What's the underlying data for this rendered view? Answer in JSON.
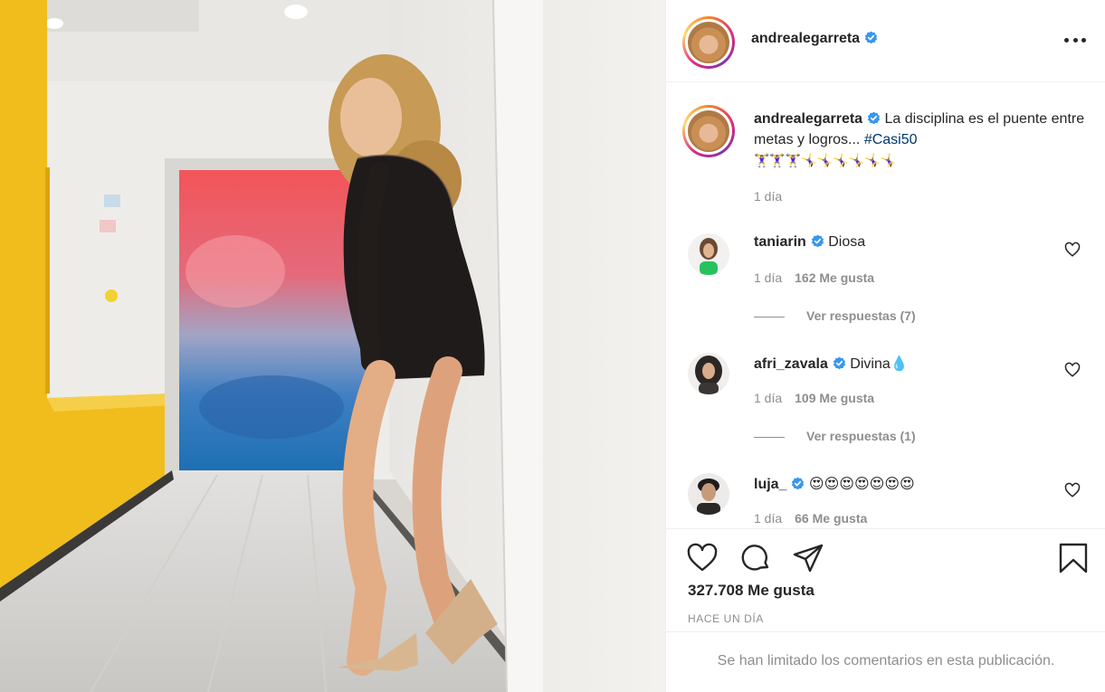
{
  "post": {
    "username": "andrealegarreta",
    "caption": {
      "text": "La disciplina es el puente entre metas y logros... ",
      "hashtag": "#Casi50",
      "emoji_row": "🏋️‍♀️🏋️‍♀️🏋️‍♀️🤸‍♀️🤸‍♀️🤸‍♀️🤸‍♀️🤸‍♀️🤸‍♀️",
      "time": "1 día"
    },
    "comments": [
      {
        "username": "taniarin",
        "text": "Diosa",
        "time": "1 día",
        "likes": "162 Me gusta",
        "replies": "Ver respuestas (7)"
      },
      {
        "username": "afri_zavala",
        "text": "Divina💧",
        "time": "1 día",
        "likes": "109 Me gusta",
        "replies": "Ver respuestas (1)"
      },
      {
        "username": "luja_",
        "text": "😍😍😍😍😍😍😍",
        "time": "1 día",
        "likes": "66 Me gusta"
      }
    ],
    "likes_total": "327.708 Me gusta",
    "posted": "HACE UN DÍA",
    "comments_limited": "Se han limitado los comentarios en esta publicación."
  },
  "colors": {
    "verified": "#3897f0",
    "hashtag": "#00376b",
    "muted": "#8e8e8e",
    "text": "#262626"
  },
  "icons": [
    "more-icon",
    "heart-icon",
    "comment-icon",
    "share-icon",
    "bookmark-icon",
    "verified-icon"
  ]
}
